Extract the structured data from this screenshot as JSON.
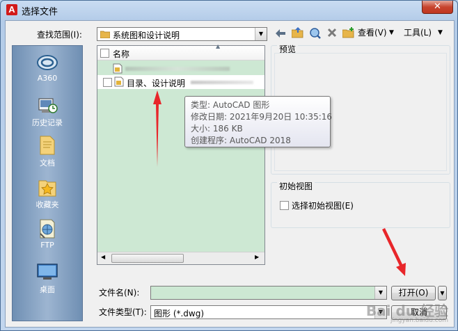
{
  "window": {
    "title": "选择文件",
    "close": "✕",
    "logo": "A"
  },
  "lookin": {
    "label": "查找范围(I):",
    "value": "系统图和设计说明"
  },
  "toolbar": {
    "view_label": "查看(V)",
    "tools_label": "工具(L)"
  },
  "places": [
    {
      "label": "A360",
      "icon": "a360-cloud-icon"
    },
    {
      "label": "历史记录",
      "icon": "history-icon"
    },
    {
      "label": "文档",
      "icon": "documents-folder-icon"
    },
    {
      "label": "收藏夹",
      "icon": "favorites-folder-icon"
    },
    {
      "label": "FTP",
      "icon": "ftp-icon"
    },
    {
      "label": "桌面",
      "icon": "desktop-icon"
    }
  ],
  "filelist": {
    "column_header": "名称",
    "files": [
      {
        "name": "目录、设计说明"
      }
    ]
  },
  "tooltip": {
    "type": "类型: AutoCAD 图形",
    "modified": "修改日期: 2021年9月20日 10:35:16",
    "size": "大小: 186 KB",
    "creator": "创建程序: AutoCAD 2018"
  },
  "preview": {
    "title": "预览"
  },
  "initial_view": {
    "title": "初始视图",
    "checkbox_label": "选择初始视图(E)"
  },
  "filename": {
    "label": "文件名(N):",
    "value": ""
  },
  "filetype": {
    "label": "文件类型(T):",
    "value": "图形 (*.dwg)"
  },
  "buttons": {
    "open": "打开(O)",
    "cancel": "取消"
  },
  "watermark": {
    "line1": "Bai du 经验",
    "line2": "jingyan.baidu.com"
  },
  "colors": {
    "file_list_bg": "#cde8d3",
    "sidebar": "#8aa6c7",
    "arrow": "#e8262a"
  }
}
